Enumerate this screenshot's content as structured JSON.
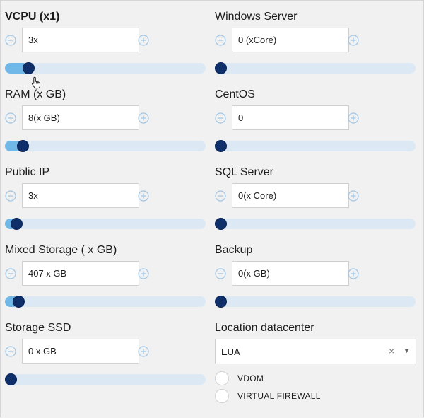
{
  "left_fields": [
    {
      "label": "VCPU (x1)",
      "value": "3x",
      "fill_fraction": 0.12,
      "show_fill": true
    },
    {
      "label": "RAM (x GB)",
      "value": "8(x GB)",
      "fill_fraction": 0.09,
      "show_fill": true
    },
    {
      "label": "Public IP",
      "value": "3x",
      "fill_fraction": 0.06,
      "show_fill": true
    },
    {
      "label": "Mixed Storage ( x GB)",
      "value": "407 x GB",
      "fill_fraction": 0.07,
      "show_fill": true
    },
    {
      "label": "Storage SSD",
      "value": "0 x GB",
      "fill_fraction": 0.03,
      "show_fill": false
    }
  ],
  "right_fields": [
    {
      "label": "Windows Server",
      "value": "0 (xCore)",
      "fill_fraction": 0.03,
      "show_fill": false
    },
    {
      "label": "CentOS",
      "value": "0",
      "fill_fraction": 0.03,
      "show_fill": false
    },
    {
      "label": "SQL Server",
      "value": "0(x Core)",
      "fill_fraction": 0.03,
      "show_fill": false
    },
    {
      "label": "Backup",
      "value": "0(x GB)",
      "fill_fraction": 0.03,
      "show_fill": false
    }
  ],
  "location": {
    "label": "Location datacenter",
    "selected": "EUA",
    "clear_symbol": "×",
    "caret_symbol": "▼"
  },
  "options": [
    {
      "label": "VDOM",
      "checked": false
    },
    {
      "label": "VIRTUAL FIREWALL",
      "checked": false
    }
  ],
  "icons": {
    "decrement": "minus-circle-icon",
    "increment": "plus-circle-icon",
    "cursor": "hand-pointer-icon"
  },
  "colors": {
    "track": "#dce9f5",
    "fill": "#6fb8e8",
    "knob": "#0e2f6a",
    "step_icon": "#9fc6e6"
  }
}
